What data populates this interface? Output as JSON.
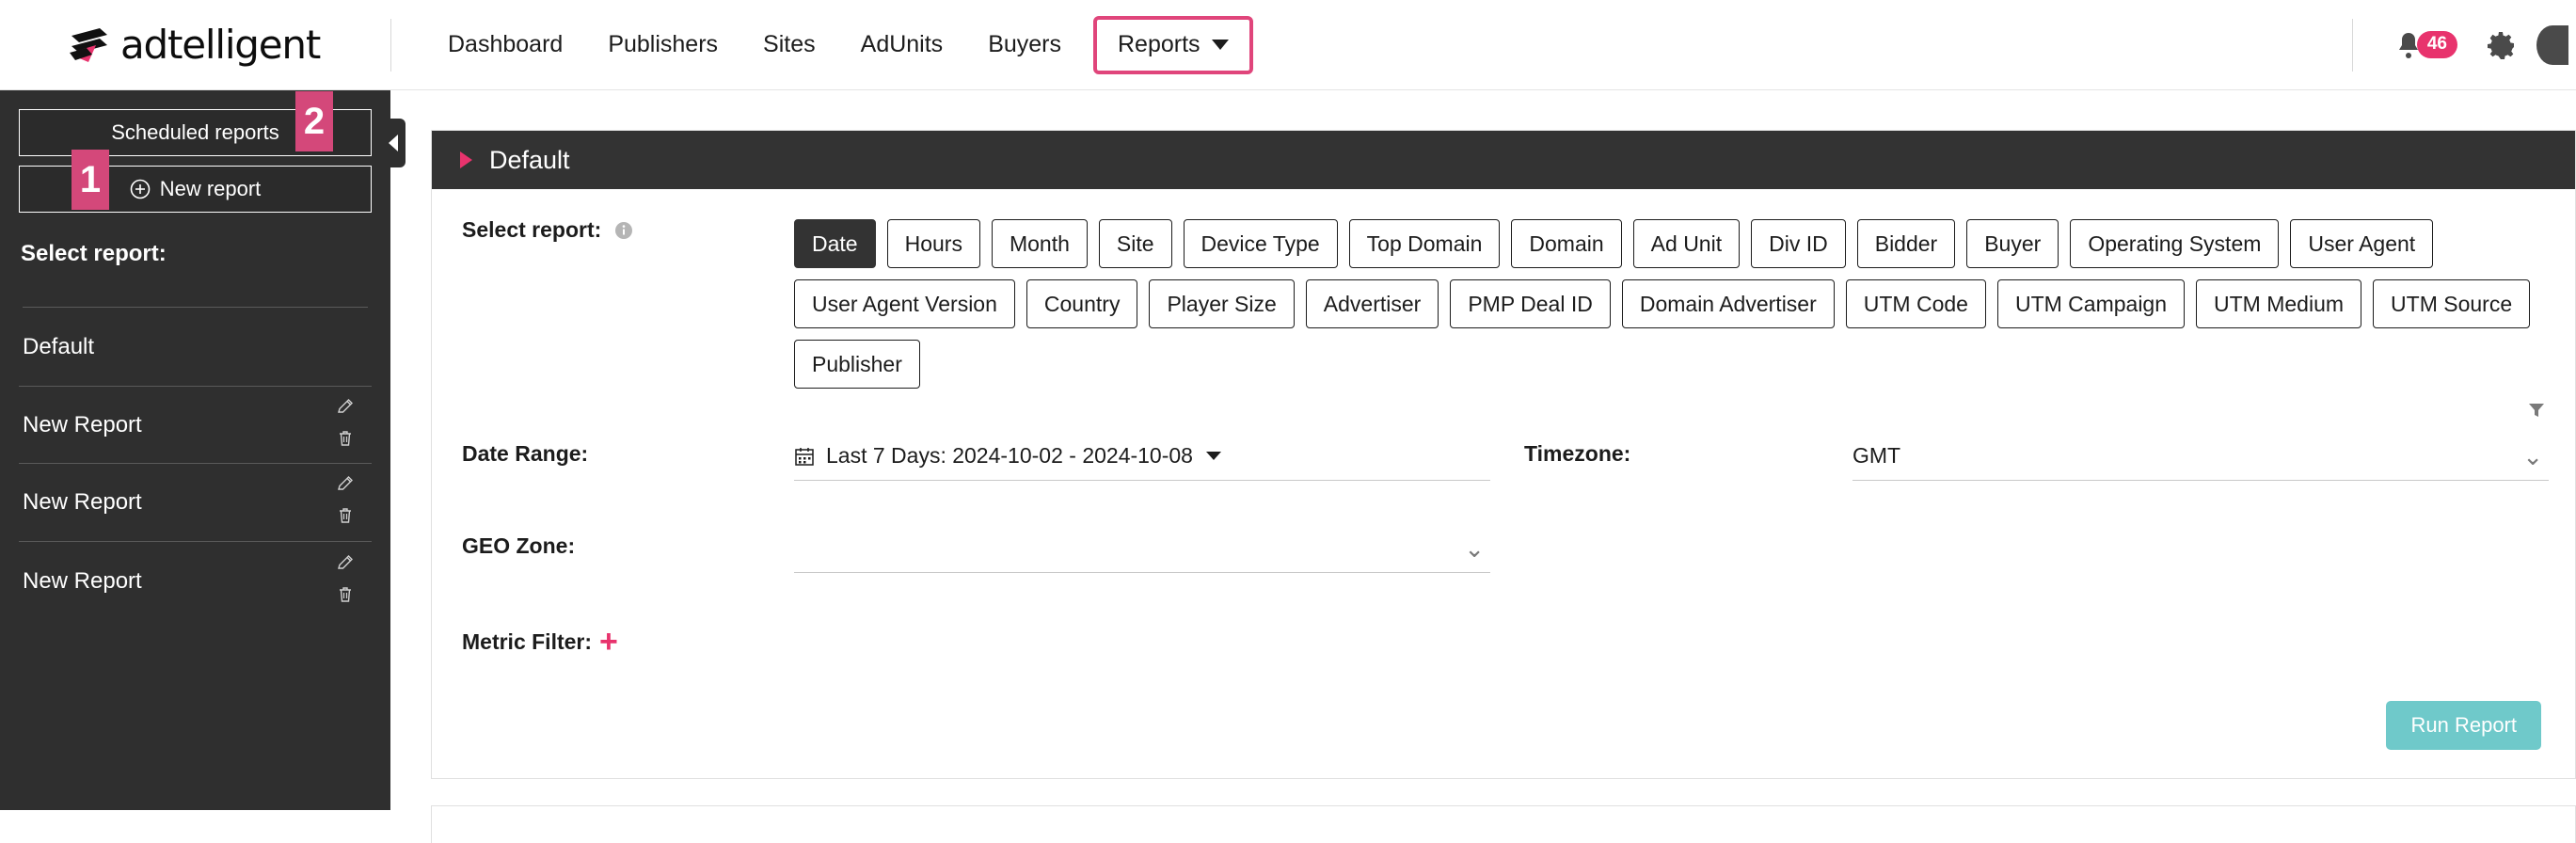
{
  "brand": {
    "name": "adtelligent",
    "accent_pink": "#e8336d",
    "highlight_pink": "#e0457b",
    "dark_sidebar": "#2f2f2f",
    "teal": "#6fc9ca"
  },
  "topnav": {
    "items": [
      {
        "label": "Dashboard",
        "active": false
      },
      {
        "label": "Publishers",
        "active": false
      },
      {
        "label": "Sites",
        "active": false
      },
      {
        "label": "AdUnits",
        "active": false
      },
      {
        "label": "Buyers",
        "active": false
      },
      {
        "label": "Reports",
        "active": true,
        "has_caret": true
      }
    ],
    "notifications_count": "46",
    "icons": [
      "bell-icon",
      "gear-icon",
      "avatar"
    ]
  },
  "sidebar": {
    "scheduled_reports_label": "Scheduled reports",
    "scheduled_reports_badge": "2",
    "new_report_label": "New report",
    "new_report_badge": "1",
    "select_report_label": "Select report:",
    "reports": [
      {
        "name": "Default",
        "editable": false
      },
      {
        "name": "New Report",
        "editable": true
      },
      {
        "name": "New Report",
        "editable": true
      },
      {
        "name": "New Report",
        "editable": true
      }
    ]
  },
  "panel": {
    "title": "Default",
    "select_report_label": "Select report:",
    "report_types": [
      {
        "label": "Date",
        "selected": true
      },
      {
        "label": "Hours",
        "selected": false
      },
      {
        "label": "Month",
        "selected": false
      },
      {
        "label": "Site",
        "selected": false
      },
      {
        "label": "Device Type",
        "selected": false
      },
      {
        "label": "Top Domain",
        "selected": false
      },
      {
        "label": "Domain",
        "selected": false
      },
      {
        "label": "Ad Unit",
        "selected": false
      },
      {
        "label": "Div ID",
        "selected": false
      },
      {
        "label": "Bidder",
        "selected": false
      },
      {
        "label": "Buyer",
        "selected": false
      },
      {
        "label": "Operating System",
        "selected": false
      },
      {
        "label": "User Agent",
        "selected": false
      },
      {
        "label": "User Agent Version",
        "selected": false
      },
      {
        "label": "Country",
        "selected": false
      },
      {
        "label": "Player Size",
        "selected": false
      },
      {
        "label": "Advertiser",
        "selected": false
      },
      {
        "label": "PMP Deal ID",
        "selected": false
      },
      {
        "label": "Domain Advertiser",
        "selected": false
      },
      {
        "label": "UTM Code",
        "selected": false
      },
      {
        "label": "UTM Campaign",
        "selected": false
      },
      {
        "label": "UTM Medium",
        "selected": false
      },
      {
        "label": "UTM Source",
        "selected": false
      },
      {
        "label": "Publisher",
        "selected": false
      }
    ],
    "date_range_label": "Date Range:",
    "date_range_value": "Last 7 Days: 2024-10-02 - 2024-10-08",
    "timezone_label": "Timezone:",
    "timezone_value": "GMT",
    "geo_zone_label": "GEO Zone:",
    "geo_zone_value": "",
    "metric_filter_label": "Metric Filter:",
    "metric_filter_add": "+",
    "run_report_label": "Run Report"
  }
}
